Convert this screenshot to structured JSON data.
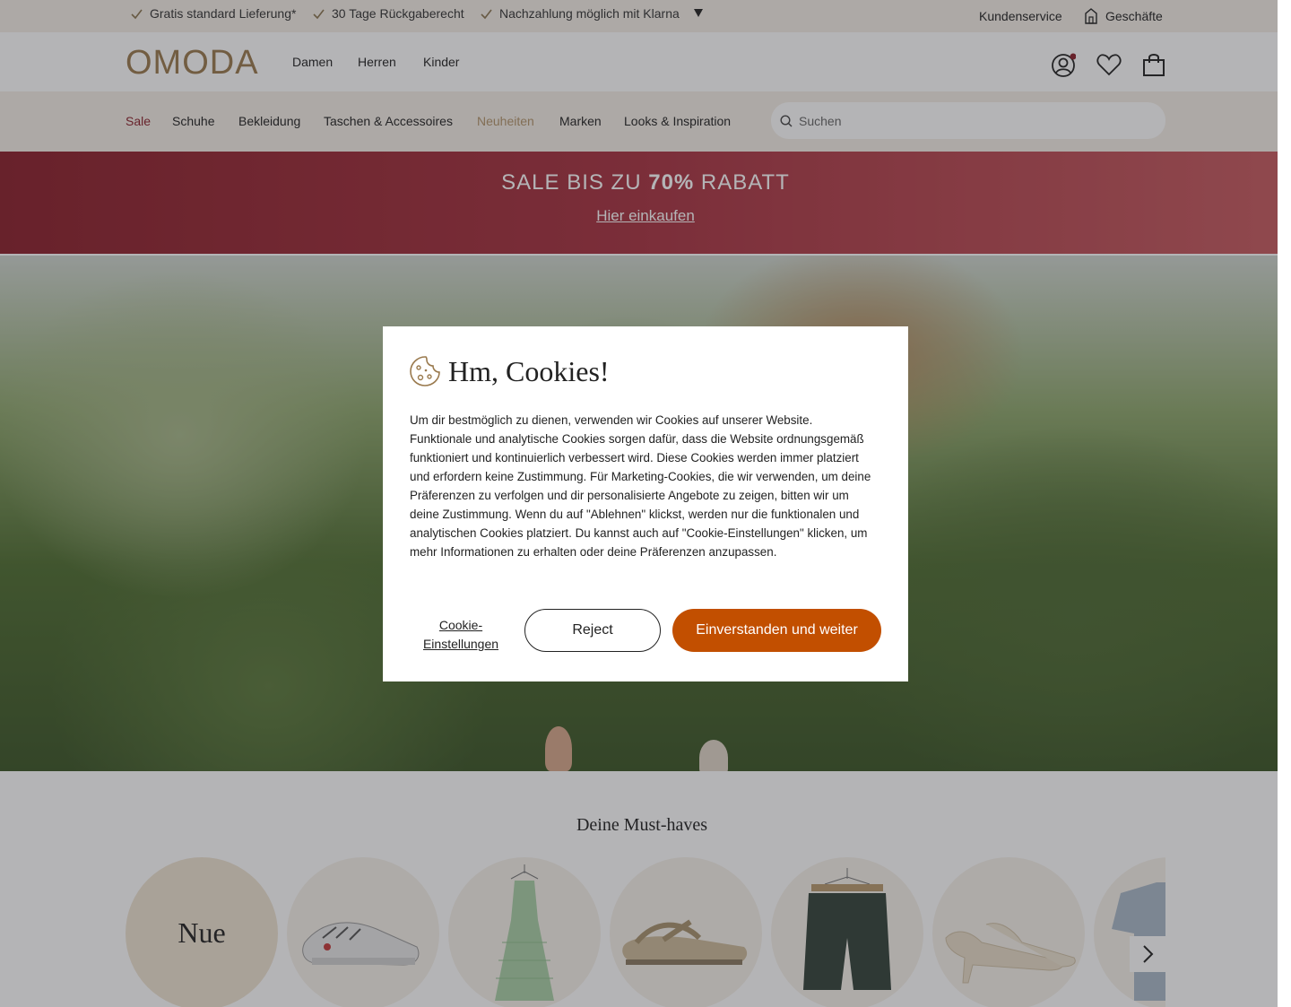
{
  "usp": {
    "items": [
      "Gratis standard Lieferung*",
      "30 Tage Rückgaberecht",
      "Nachzahlung möglich mit Klarna"
    ],
    "customer_service": "Kundenservice",
    "stores": "Geschäfte"
  },
  "header": {
    "logo": "OMODA",
    "nav": [
      "Damen",
      "Herren",
      "Kinder"
    ]
  },
  "categories": {
    "items": [
      "Sale",
      "Schuhe",
      "Bekleidung",
      "Taschen & Accessoires",
      "Neuheiten",
      "Marken",
      "Looks & Inspiration"
    ],
    "sale_color": "#8b1f2a",
    "new_color": "#b3946a"
  },
  "search": {
    "placeholder": "Suchen"
  },
  "sale_banner": {
    "title_prefix": "SALE BIS ZU ",
    "title_bold": "70%",
    "title_suffix": " RABATT",
    "link": "Hier einkaufen"
  },
  "musthaves": {
    "title": "Deine Must-haves",
    "first_label": "Nue"
  },
  "cookie_modal": {
    "title": "Hm, Cookies!",
    "text": "Um dir bestmöglich zu dienen, verwenden wir Cookies auf unserer Website. Funktionale und analytische Cookies sorgen dafür, dass die Website ordnungsgemäß funktioniert und kontinuierlich verbessert wird. Diese Cookies werden immer platziert und erfordern keine Zustimmung. Für Marketing-Cookies, die wir verwenden, um deine Präferenzen zu verfolgen und dir personalisierte Angebote zu zeigen, bitten wir um deine Zustimmung. Wenn du auf \"Ablehnen\" klickst, werden nur die funktionalen und analytischen Cookies platziert. Du kannst auch auf \"Cookie-Einstellungen\" klicken, um mehr Informationen zu erhalten oder deine Präferenzen anzupassen.",
    "settings_label": "Cookie-Einstellungen",
    "reject_label": "Reject",
    "accept_label": "Einverstanden und weiter",
    "accept_color": "#c24f00"
  }
}
